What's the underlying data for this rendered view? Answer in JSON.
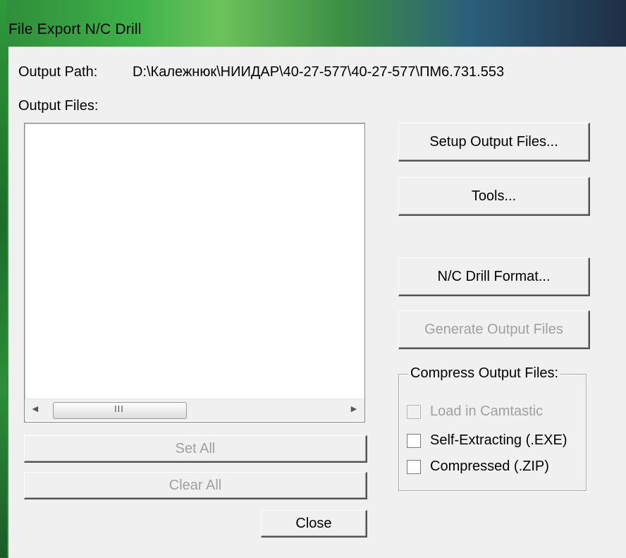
{
  "window": {
    "title": "File Export N/C Drill"
  },
  "output_path": {
    "label": "Output Path:",
    "value": "D:\\Калежнюк\\НИИДАР\\40-27-577\\40-27-577\\ПМ6.731.553"
  },
  "output_files": {
    "label": "Output Files:",
    "items": []
  },
  "scrollbar": {
    "left_arrow": "◄",
    "right_arrow": "►",
    "grip": "III"
  },
  "buttons": {
    "setup_output_files": "Setup Output Files...",
    "tools": "Tools...",
    "nc_drill_format": "N/C Drill Format...",
    "generate_output_files": "Generate Output Files",
    "set_all": "Set All",
    "clear_all": "Clear All",
    "close": "Close"
  },
  "compress": {
    "title": "Compress Output Files:",
    "options": [
      {
        "label": "Load in Camtastic",
        "checked": false,
        "enabled": false
      },
      {
        "label": "Self-Extracting (.EXE)",
        "checked": false,
        "enabled": true
      },
      {
        "label": "Compressed (.ZIP)",
        "checked": false,
        "enabled": true
      }
    ]
  },
  "colors": {
    "dialog_bg": "#f0f0f0",
    "disabled_text": "#a0a0a0",
    "frame_accent": "#3fb24a"
  }
}
